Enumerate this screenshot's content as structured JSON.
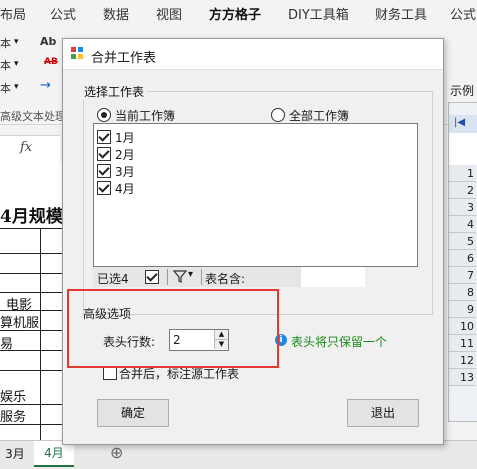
{
  "ribbon": {
    "tabs": [
      "布局",
      "公式",
      "数据",
      "视图",
      "方方格子",
      "DIY工具箱",
      "财务工具",
      "公式"
    ],
    "active_tab": "方方格子",
    "left_fragments": [
      "本",
      "本",
      "本"
    ],
    "group_caption": "高级文本处理",
    "ab_label": "Ab",
    "ab_strike": "AB"
  },
  "formula_bar": {
    "fx": "fx"
  },
  "sheet": {
    "title": "4月规模",
    "rows": [
      "",
      "",
      "电影",
      "算机服",
      "易",
      "",
      "娱乐",
      "服务"
    ]
  },
  "sheet_tabs": [
    "3月",
    "4月"
  ],
  "add_sheet": "⊕",
  "preview": {
    "label": "示例",
    "row_numbers": [
      "1",
      "2",
      "3",
      "4",
      "5",
      "6",
      "7",
      "8",
      "9",
      "10",
      "11",
      "12",
      "13"
    ]
  },
  "dialog": {
    "title": "合并工作表",
    "select_group": "选择工作表",
    "radio_current": "当前工作簿",
    "radio_all": "全部工作簿",
    "sheets": [
      {
        "name": "1月",
        "checked": true
      },
      {
        "name": "2月",
        "checked": true
      },
      {
        "name": "3月",
        "checked": true
      },
      {
        "name": "4月",
        "checked": true
      }
    ],
    "selected_count": "已选4",
    "filter_arrow": "▾",
    "table_name_label": "表名含:",
    "table_name_value": "",
    "adv_group": "高级选项",
    "header_rows_label": "表头行数:",
    "header_rows_value": "2",
    "info_text": "表头将只保留一个",
    "mark_source": "合并后，标注源工作表",
    "ok": "确定",
    "exit": "退出"
  },
  "colors": {
    "highlight": "#e53935",
    "excel_green": "#217346",
    "info_green": "#1a8a1a"
  }
}
